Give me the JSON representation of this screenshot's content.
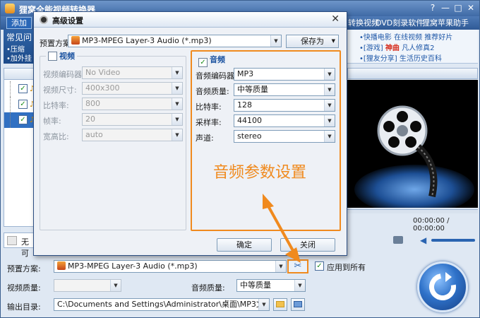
{
  "main": {
    "title": "狸窝全能视频转换器",
    "window_buttons": [
      "?",
      "—",
      "□",
      "✕"
    ],
    "menubar": {
      "add_button": "添加",
      "items": [
        "转换视频",
        "DVD刻录软件",
        "狸窝苹果助手"
      ]
    },
    "left_panel": {
      "title": "常见问",
      "lines": [
        "•压缩 ",
        "•加外挂"
      ]
    },
    "ads": {
      "line1": [
        "•快播电影",
        "在线视频",
        "推荐好片"
      ],
      "line2_a": "•[游戏]",
      "line2_hot": "神曲",
      "line2_b": "凡人修真2",
      "line3": "•[狸友分享] 生活历史百科"
    },
    "bottom_strip_text": "无可",
    "time_display": "00:00:00 / 00:00:00",
    "settings": {
      "preset_label": "预置方案:",
      "preset_value": "MP3-MPEG Layer-3 Audio (*.mp3)",
      "apply_all": "应用到所有",
      "video_quality_label": "视频质量:",
      "video_quality_value": "",
      "audio_quality_label": "音频质量:",
      "audio_quality_value": "中等质量",
      "output_label": "输出目录:",
      "output_value": "C:\\Documents and Settings\\Administrator\\桌面\\MP3文件"
    }
  },
  "dialog": {
    "title": "高级设置",
    "preset_label": "预置方案:",
    "preset_value": "MP3-MPEG Layer-3 Audio (*.mp3)",
    "save_as": "保存为",
    "video": {
      "title": "视频",
      "checked": false,
      "rows": [
        {
          "label": "视频编码器:",
          "value": "No Video"
        },
        {
          "label": "视频尺寸:",
          "value": "400x300"
        },
        {
          "label": "比特率:",
          "value": "800"
        },
        {
          "label": "帧率:",
          "value": "20"
        },
        {
          "label": "宽高比:",
          "value": "auto"
        }
      ]
    },
    "audio": {
      "title": "音频",
      "checked": true,
      "rows": [
        {
          "label": "音频编码器:",
          "value": "MP3"
        },
        {
          "label": "音频质量:",
          "value": "中等质量"
        },
        {
          "label": "比特率:",
          "value": "128"
        },
        {
          "label": "采样率:",
          "value": "44100"
        },
        {
          "label": "声道:",
          "value": "stereo"
        }
      ]
    },
    "annotation": "音频参数设置",
    "ok": "确定",
    "close": "关闭"
  },
  "colors": {
    "accent_orange": "#f08a1e",
    "title_blue": "#3f6aa6",
    "dialog_bg": "#eef1f6"
  }
}
